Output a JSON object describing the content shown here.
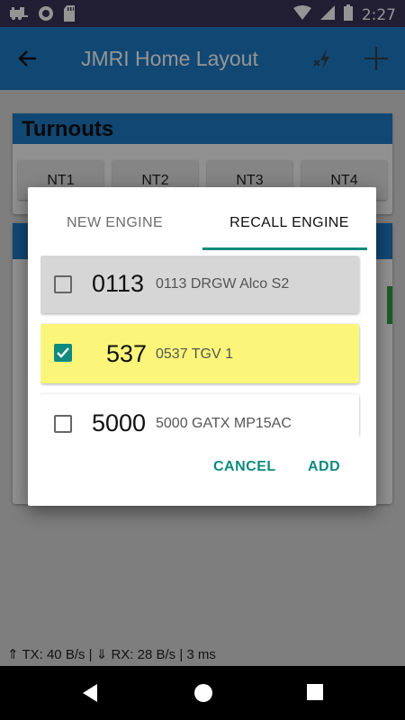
{
  "status_bar": {
    "time": "2:27",
    "left_icons": [
      "train-icon",
      "record-icon",
      "sd-card-icon"
    ],
    "right_icons": [
      "wifi-icon",
      "signal-icon",
      "battery-icon"
    ]
  },
  "app_bar": {
    "title": "JMRI Home Layout",
    "icons": [
      "back-arrow-icon",
      "power-off-icon",
      "plus-icon"
    ]
  },
  "turnouts": {
    "header": "Turnouts",
    "buttons": [
      "NT1",
      "NT2",
      "NT3",
      "NT4"
    ]
  },
  "dialog": {
    "tabs": [
      {
        "label": "NEW ENGINE",
        "selected": false
      },
      {
        "label": "RECALL ENGINE",
        "selected": true
      }
    ],
    "engines": [
      {
        "number": "0113",
        "name": "0113 DRGW Alco S2",
        "checked": false,
        "bg": "#d6d6d6"
      },
      {
        "number": "537",
        "name": "0537 TGV 1",
        "checked": true,
        "bg": "#fbf67a"
      },
      {
        "number": "5000",
        "name": "5000 GATX MP15AC",
        "checked": false,
        "bg": "#ffffff"
      }
    ],
    "actions": {
      "cancel": "CANCEL",
      "add": "ADD"
    }
  },
  "footer": {
    "stats": "⇑ TX: 40 B/s | ⇓ RX: 28 B/s | 3 ms"
  },
  "nav_bar": {
    "icons": [
      "back-triangle-icon",
      "home-circle-icon",
      "recents-square-icon"
    ]
  },
  "colors": {
    "accent": "#0f8a7e",
    "app_bar": "#1e7dc6",
    "status_bar": "#3a3357"
  }
}
